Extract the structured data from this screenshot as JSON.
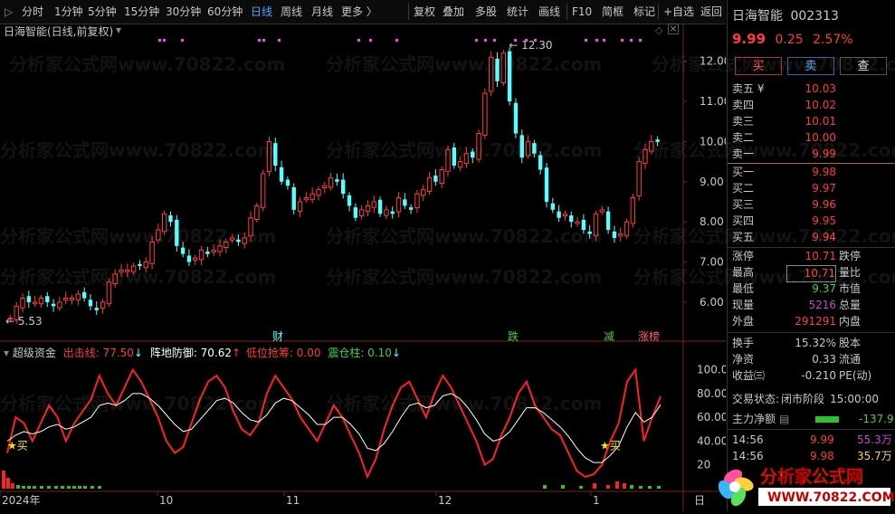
{
  "toolbar": {
    "items": [
      "分时",
      "1分钟",
      "5分钟",
      "15分钟",
      "30分钟",
      "60分钟",
      "日线",
      "周线",
      "月线",
      "更多 〉",
      "复权",
      "叠加",
      "多股",
      "统计",
      "画线",
      "F10",
      "简框",
      "标记",
      "+自选",
      "返回"
    ],
    "active": "日线"
  },
  "chart_header": {
    "title": "日海智能(日线,前复权)"
  },
  "chart_data": [
    {
      "type": "candlestick",
      "title": "日海智能(日线,前复权)",
      "y_ticks": [
        "12.00",
        "11.00",
        "10.00",
        "9.00",
        "8.00",
        "7.00",
        "6.00"
      ],
      "ylim": [
        5.3,
        12.6
      ],
      "x_ticks": [
        "2024年",
        "10",
        "11",
        "12",
        "1"
      ],
      "annotations": {
        "high": "12.30",
        "low": "5.53"
      },
      "events": [
        "财",
        "跌",
        "减",
        "涨榜"
      ],
      "closes_approx": [
        5.6,
        5.9,
        6.1,
        6.0,
        6.0,
        6.1,
        6.0,
        5.9,
        6.0,
        6.1,
        6.1,
        6.2,
        6.1,
        5.9,
        5.8,
        6.0,
        6.5,
        6.7,
        6.8,
        6.8,
        6.9,
        6.9,
        7.0,
        7.5,
        7.8,
        8.2,
        8.0,
        7.4,
        7.2,
        7.0,
        7.1,
        7.3,
        7.2,
        7.3,
        7.4,
        7.5,
        7.6,
        7.5,
        7.6,
        8.1,
        8.4,
        9.2,
        10.0,
        9.4,
        9.0,
        8.9,
        8.3,
        8.5,
        8.6,
        8.7,
        8.8,
        8.9,
        9.1,
        9.0,
        8.7,
        8.4,
        8.1,
        8.3,
        8.4,
        8.5,
        8.2,
        8.3,
        8.2,
        8.6,
        8.4,
        8.3,
        8.7,
        8.8,
        9.1,
        9.0,
        9.3,
        9.8,
        9.4,
        9.5,
        9.7,
        9.6,
        10.2,
        11.2,
        12.1,
        11.5,
        12.2,
        11.0,
        10.2,
        9.6,
        10.0,
        9.7,
        9.3,
        8.5,
        8.3,
        8.1,
        8.2,
        8.0,
        8.0,
        7.8,
        7.7,
        8.2,
        8.3,
        7.8,
        7.6,
        7.7,
        8.0,
        8.6,
        9.5,
        9.8,
        10.0,
        9.99
      ]
    },
    {
      "type": "line",
      "title": "超级资金",
      "y_ticks": [
        "100.00",
        "80.00",
        "60.00",
        "40.00",
        "20"
      ],
      "ylim": [
        0,
        105
      ],
      "series": [
        {
          "name": "出击线",
          "values": [
            30,
            60,
            55,
            40,
            55,
            70,
            60,
            40,
            55,
            65,
            75,
            95,
            80,
            70,
            85,
            100,
            90,
            75,
            60,
            40,
            30,
            35,
            55,
            75,
            90,
            95,
            85,
            65,
            50,
            45,
            55,
            80,
            95,
            85,
            75,
            60,
            50,
            40,
            55,
            70,
            60,
            45,
            30,
            10,
            25,
            50,
            70,
            85,
            90,
            75,
            60,
            80,
            95,
            85,
            70,
            55,
            40,
            20,
            25,
            45,
            60,
            80,
            90,
            70,
            60,
            50,
            45,
            30,
            15,
            10,
            12,
            20,
            40,
            55,
            90,
            100,
            40,
            60,
            77.5
          ]
        },
        {
          "name": "阵地防御",
          "values": [
            40,
            45,
            48,
            46,
            48,
            52,
            54,
            50,
            52,
            56,
            60,
            70,
            72,
            70,
            74,
            80,
            80,
            76,
            70,
            62,
            54,
            48,
            50,
            58,
            66,
            74,
            76,
            72,
            64,
            58,
            56,
            62,
            72,
            76,
            74,
            68,
            62,
            54,
            54,
            60,
            60,
            54,
            46,
            34,
            32,
            38,
            48,
            60,
            70,
            72,
            68,
            70,
            78,
            80,
            76,
            68,
            58,
            46,
            40,
            42,
            48,
            58,
            68,
            68,
            64,
            58,
            52,
            44,
            34,
            26,
            22,
            22,
            28,
            36,
            52,
            64,
            56,
            60,
            70.62
          ]
        }
      ],
      "legend_values": {
        "出击线": "77.50",
        "阵地防御": "70.62",
        "低位抢筹": "0.00",
        "震仓柱": "0.10"
      },
      "markers": [
        "★买",
        "★买"
      ]
    }
  ],
  "indicator_header": {
    "name": "超级资金",
    "l1": "出击线: 77.50",
    "l2": "阵地防御: 70.62",
    "l3": "低位抢筹: 0.00",
    "l4": "震仓柱: 0.10"
  },
  "right": {
    "name": "日海智能",
    "code": "002313",
    "price": "9.99",
    "change": "0.25",
    "pct": "2.57%",
    "buttons": [
      "买",
      "卖",
      "查"
    ],
    "asks": [
      {
        "label": "卖五 ¥",
        "value": "10.03"
      },
      {
        "label": "卖四",
        "value": "10.02"
      },
      {
        "label": "卖三",
        "value": "10.01"
      },
      {
        "label": "卖二",
        "value": "10.00"
      },
      {
        "label": "卖一",
        "value": "9.99"
      }
    ],
    "bids": [
      {
        "label": "买一",
        "value": "9.98"
      },
      {
        "label": "买二",
        "value": "9.97"
      },
      {
        "label": "买三",
        "value": "9.96"
      },
      {
        "label": "买四",
        "value": "9.95"
      },
      {
        "label": "买五",
        "value": "9.94"
      }
    ],
    "stats": [
      {
        "label": "涨停",
        "value": "10.71",
        "label2": "跌停"
      },
      {
        "label": "最高",
        "value": "10.71",
        "label2": "量比"
      },
      {
        "label": "最低",
        "value": "9.37",
        "label2": "市值"
      },
      {
        "label": "现量",
        "value": "5216",
        "label2": "总量"
      },
      {
        "label": "外盘",
        "value": "291291",
        "label2": "内盘"
      }
    ],
    "stats2": [
      {
        "label": "换手",
        "value": "15.32%",
        "label2": "股本"
      },
      {
        "label": "净资",
        "value": "0.33",
        "label2": "流通"
      },
      {
        "label": "收益㈢",
        "value": "-0.210",
        "label2": "PE(动)"
      }
    ],
    "trade_status_label": "交易状态:",
    "trade_status": "闭市阶段",
    "trade_time": "15:00:00",
    "net_label": "主力净额",
    "net_value": "-137.9",
    "ticks": [
      {
        "time": "14:56",
        "price": "9.99",
        "vol": "55.3万"
      },
      {
        "time": "14:56",
        "price": "9.98",
        "vol": "35.7万"
      }
    ]
  },
  "watermark": "分析家公式网www.70822.com",
  "logo": {
    "title": "分析家公式网",
    "url": "WWW.70822.COM"
  },
  "colors": {
    "up": "#ff3b3b",
    "down": "#54ffff",
    "accent": "#4aa3ff",
    "ma_white": "#ffffff",
    "line_red": "#ff2020",
    "magenta": "#ff40ff"
  }
}
